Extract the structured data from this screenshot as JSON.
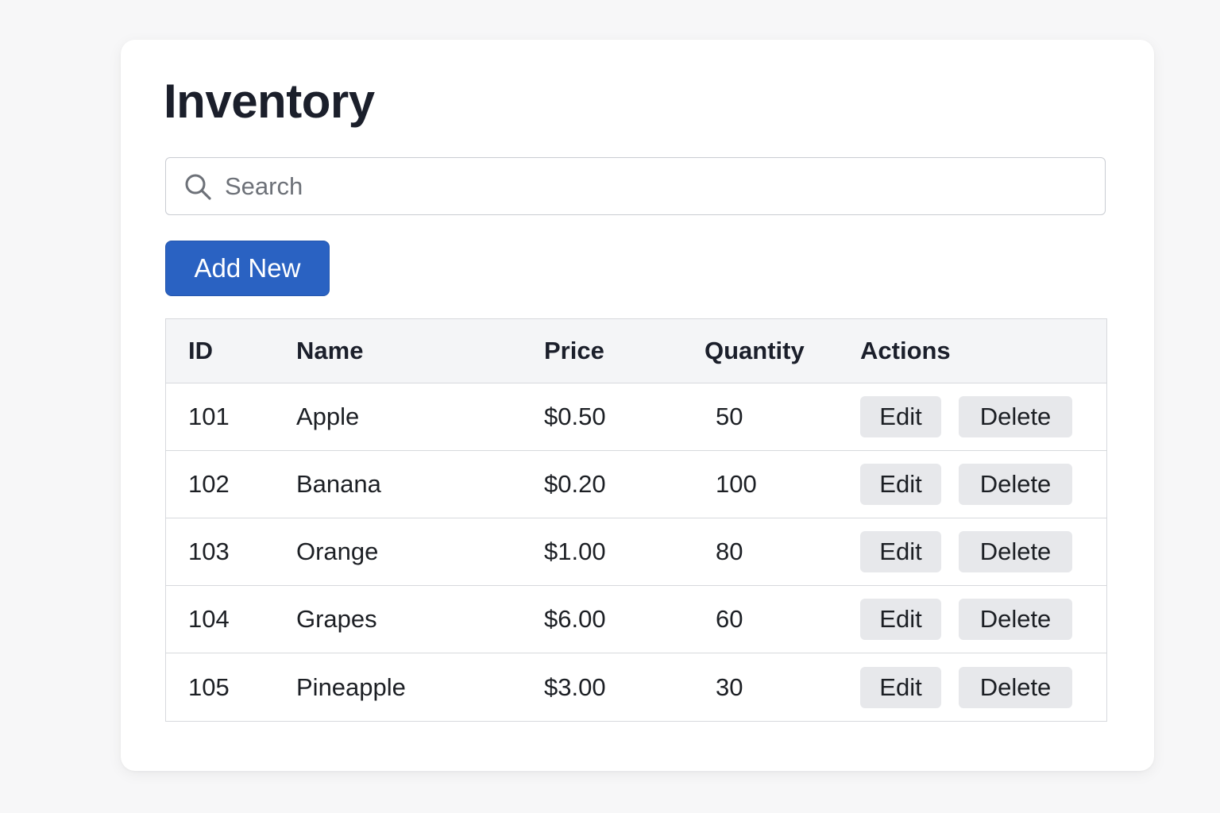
{
  "page": {
    "title": "Inventory"
  },
  "search": {
    "placeholder": "Search",
    "value": "",
    "icon": "search-icon"
  },
  "toolbar": {
    "add_label": "Add New"
  },
  "colors": {
    "primary": "#2a62c2",
    "header_bg": "#f4f5f7",
    "action_button_bg": "#e7e8eb"
  },
  "table": {
    "headers": {
      "id": "ID",
      "name": "Name",
      "price": "Price",
      "quantity": "Quantity",
      "actions": "Actions"
    },
    "rows": [
      {
        "id": "101",
        "name": "Apple",
        "price": "$0.50",
        "quantity": "50",
        "edit": "Edit",
        "delete": "Delete"
      },
      {
        "id": "102",
        "name": "Banana",
        "price": "$0.20",
        "quantity": "100",
        "edit": "Edit",
        "delete": "Delete"
      },
      {
        "id": "103",
        "name": "Orange",
        "price": "$1.00",
        "quantity": "80",
        "edit": "Edit",
        "delete": "Delete"
      },
      {
        "id": "104",
        "name": "Grapes",
        "price": "$6.00",
        "quantity": "60",
        "edit": "Edit",
        "delete": "Delete"
      },
      {
        "id": "105",
        "name": "Pineapple",
        "price": "$3.00",
        "quantity": "30",
        "edit": "Edit",
        "delete": "Delete"
      }
    ]
  }
}
